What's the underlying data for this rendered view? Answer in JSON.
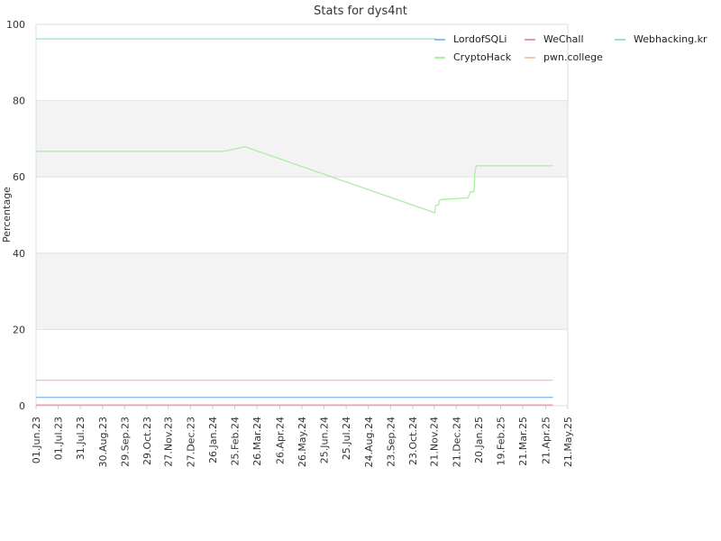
{
  "chart_data": {
    "type": "line",
    "title": "Stats for dys4nt",
    "xlabel": "",
    "ylabel": "Percentage",
    "ylim": [
      0,
      100
    ],
    "yticks": [
      0,
      20,
      40,
      60,
      80,
      100
    ],
    "xlim": [
      "2023-06-01",
      "2025-05-21"
    ],
    "grid": true,
    "grid_bands": true,
    "legend_position": "top-right",
    "xticks": [
      {
        "date": "2023-06-01",
        "label": "01.Jun.23"
      },
      {
        "date": "2023-07-01",
        "label": "01.Jul.23"
      },
      {
        "date": "2023-07-31",
        "label": "31.Jul.23"
      },
      {
        "date": "2023-08-30",
        "label": "30.Aug.23"
      },
      {
        "date": "2023-09-29",
        "label": "29.Sep.23"
      },
      {
        "date": "2023-10-29",
        "label": "29.Oct.23"
      },
      {
        "date": "2023-11-27",
        "label": "27.Nov.23"
      },
      {
        "date": "2023-12-27",
        "label": "27.Dec.23"
      },
      {
        "date": "2024-01-26",
        "label": "26.Jan.24"
      },
      {
        "date": "2024-02-25",
        "label": "25.Feb.24"
      },
      {
        "date": "2024-03-26",
        "label": "26.Mar.24"
      },
      {
        "date": "2024-04-26",
        "label": "26.Apr.24"
      },
      {
        "date": "2024-05-26",
        "label": "26.May.24"
      },
      {
        "date": "2024-06-25",
        "label": "25.Jun.24"
      },
      {
        "date": "2024-07-25",
        "label": "25.Jul.24"
      },
      {
        "date": "2024-08-24",
        "label": "24.Aug.24"
      },
      {
        "date": "2024-09-23",
        "label": "23.Sep.24"
      },
      {
        "date": "2024-10-23",
        "label": "23.Oct.24"
      },
      {
        "date": "2024-11-21",
        "label": "21.Nov.24"
      },
      {
        "date": "2024-12-21",
        "label": "21.Dec.24"
      },
      {
        "date": "2025-01-20",
        "label": "20.Jan.25"
      },
      {
        "date": "2025-02-19",
        "label": "19.Feb.25"
      },
      {
        "date": "2025-03-21",
        "label": "21.Mar.25"
      },
      {
        "date": "2025-04-21",
        "label": "21.Apr.25"
      },
      {
        "date": "2025-05-21",
        "label": "21.May.25"
      }
    ],
    "series": [
      {
        "name": "LordofSQLi",
        "color": "#8fbcf2",
        "points": [
          [
            "2023-06-01",
            2.2
          ],
          [
            "2025-05-01",
            2.2
          ]
        ]
      },
      {
        "name": "WeChall",
        "color": "#f08fc4",
        "points": [
          [
            "2023-06-01",
            0.2
          ],
          [
            "2025-05-01",
            0.2
          ]
        ]
      },
      {
        "name": "Webhacking.kr",
        "color": "#8fe8c4",
        "points": [
          [
            "2023-06-01",
            96.2
          ],
          [
            "2024-11-24",
            96.2
          ]
        ]
      },
      {
        "name": "CryptoHack",
        "color": "#a8f0a0",
        "points": [
          [
            "2023-06-01",
            66.7
          ],
          [
            "2024-02-10",
            66.7
          ],
          [
            "2024-03-10",
            67.9
          ],
          [
            "2024-11-22",
            50.6
          ],
          [
            "2024-11-23",
            52.6
          ],
          [
            "2024-11-27",
            52.6
          ],
          [
            "2024-11-28",
            53.8
          ],
          [
            "2024-12-01",
            54.1
          ],
          [
            "2025-01-06",
            54.5
          ],
          [
            "2025-01-09",
            56.1
          ],
          [
            "2025-01-14",
            56.1
          ],
          [
            "2025-01-15",
            61.0
          ],
          [
            "2025-01-17",
            62.9
          ],
          [
            "2025-05-01",
            62.9
          ]
        ]
      },
      {
        "name": "pwn.college",
        "color": "#f7c8b0",
        "points": [
          [
            "2023-06-01",
            6.7
          ],
          [
            "2025-05-01",
            6.7
          ]
        ]
      }
    ]
  }
}
